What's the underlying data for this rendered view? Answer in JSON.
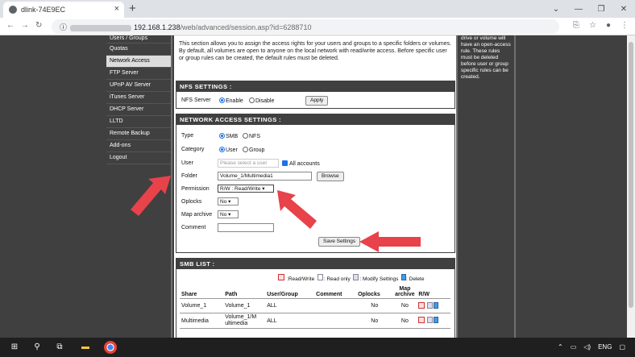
{
  "browser": {
    "tab_title": "dlink-74E9EC",
    "tab_close": "×",
    "new_tab": "+",
    "url_host": "192.168.1.238",
    "url_path": "/web/advanced/session.asp?id=6288710"
  },
  "nav": {
    "items": [
      {
        "label": "Users / Groups"
      },
      {
        "label": "Quotas"
      },
      {
        "label": "Network Access"
      },
      {
        "label": "FTP Server"
      },
      {
        "label": "UPnP AV Server"
      },
      {
        "label": "iTunes Server"
      },
      {
        "label": "DHCP Server"
      },
      {
        "label": "LLTD"
      },
      {
        "label": "Remote Backup"
      },
      {
        "label": "Add-ons"
      },
      {
        "label": "Logout"
      }
    ],
    "active_index": 2
  },
  "intro_text": "This section allows you to assign the access rights for your users and groups to a specific folders or volumes. By default, all volumes are open to anyone on the local network with read/write access. Before specific user or group rules can be created, the default rules must be deleted.",
  "nfs": {
    "heading": "NFS SETTINGS :",
    "label": "NFS Server",
    "enable": "Enable",
    "disable": "Disable",
    "apply": "Apply"
  },
  "network_access": {
    "heading": "NETWORK ACCESS SETTINGS :",
    "type_label": "Type",
    "type_smb": "SMB",
    "type_nfs": "NFS",
    "category_label": "Category",
    "category_user": "User",
    "category_group": "Group",
    "user_label": "User",
    "user_placeholder": "Please select a user",
    "all_accounts": "All accounts",
    "folder_label": "Folder",
    "folder_value": "Volume_1/Multimedia1",
    "browse": "Browse",
    "permission_label": "Permission",
    "permission_value": "R/W : Read/Write",
    "oplocks_label": "Oplocks",
    "oplocks_value": "No",
    "maparchive_label": "Map archive",
    "maparchive_value": "No",
    "comment_label": "Comment",
    "comment_value": "",
    "save": "Save Settings"
  },
  "smb_list": {
    "heading": "SMB LIST :",
    "legend": [
      ":Read/Write",
      ": Read only",
      ": Modify Settings",
      ": Delete"
    ],
    "columns": [
      "Share",
      "Path",
      "User/Group",
      "Comment",
      "Oplocks",
      "Map archive",
      "R/W"
    ],
    "rows": [
      {
        "share": "Volume_1",
        "path": "Volume_1",
        "user": "ALL",
        "comment": "",
        "oplocks": "No",
        "map_archive": "No"
      },
      {
        "share": "Multimedia",
        "path": "Volume_1/M ultimedia",
        "user": "ALL",
        "comment": "",
        "oplocks": "No",
        "map_archive": "No"
      }
    ]
  },
  "help_text": "drive or volume will have an open-access rule. These rules must be deleted before user or group specific rules can be created.",
  "taskbar": {
    "lang": "ENG"
  },
  "colors": {
    "arrow": "#e8424a",
    "nav_bg": "#404040",
    "section_bg": "#404040"
  }
}
